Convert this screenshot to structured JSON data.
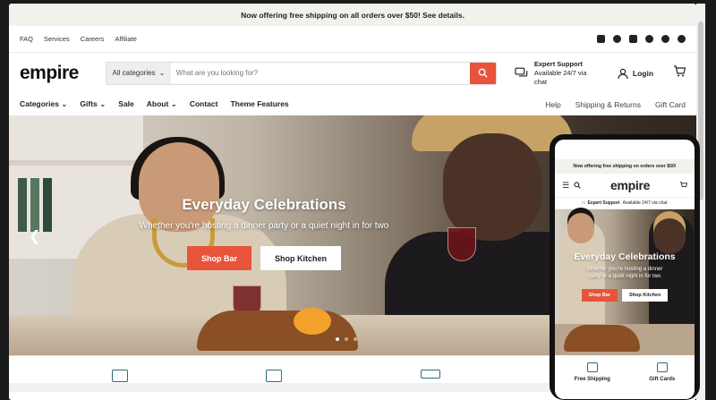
{
  "announcement": "Now offering free shipping on all orders over $50! See details.",
  "utility_links": [
    "FAQ",
    "Services",
    "Careers",
    "Affiliate"
  ],
  "social_icons": [
    "email-icon",
    "facebook-icon",
    "instagram-icon",
    "pinterest-icon",
    "snapchat-icon",
    "tiktok-icon"
  ],
  "header": {
    "logo": "empire",
    "category_select": "All categories",
    "search_placeholder": "What are you looking for?",
    "support_title": "Expert Support",
    "support_sub": "Available 24/7 via chat",
    "login": "Login"
  },
  "nav": {
    "left": [
      "Categories",
      "Gifts",
      "Sale",
      "About",
      "Contact",
      "Theme Features"
    ],
    "right": [
      "Help",
      "Shipping & Returns",
      "Gift Card"
    ]
  },
  "hero": {
    "title": "Everyday Celebrations",
    "subtitle": "Whether you're hosting a dinner party or a quiet night in for two",
    "btn_primary": "Shop Bar",
    "btn_secondary": "Shop Kitchen"
  },
  "mobile": {
    "announcement": "Now offering free shipping on orders over $50!",
    "logo": "empire",
    "support_title": "Expert Support",
    "support_sub": "Available 24/7 via chat",
    "hero_title": "Everyday Celebrations",
    "hero_subtitle": "Whether you're hosting a dinner party or a quiet night in for two",
    "btn_primary": "Shop Bar",
    "btn_secondary": "Shop Kitchen",
    "features": [
      "Free Shipping",
      "Gift Cards"
    ]
  },
  "colors": {
    "accent": "#e8543a",
    "announce_bg": "#f3f1ec",
    "icon_teal": "#2c6e78"
  }
}
